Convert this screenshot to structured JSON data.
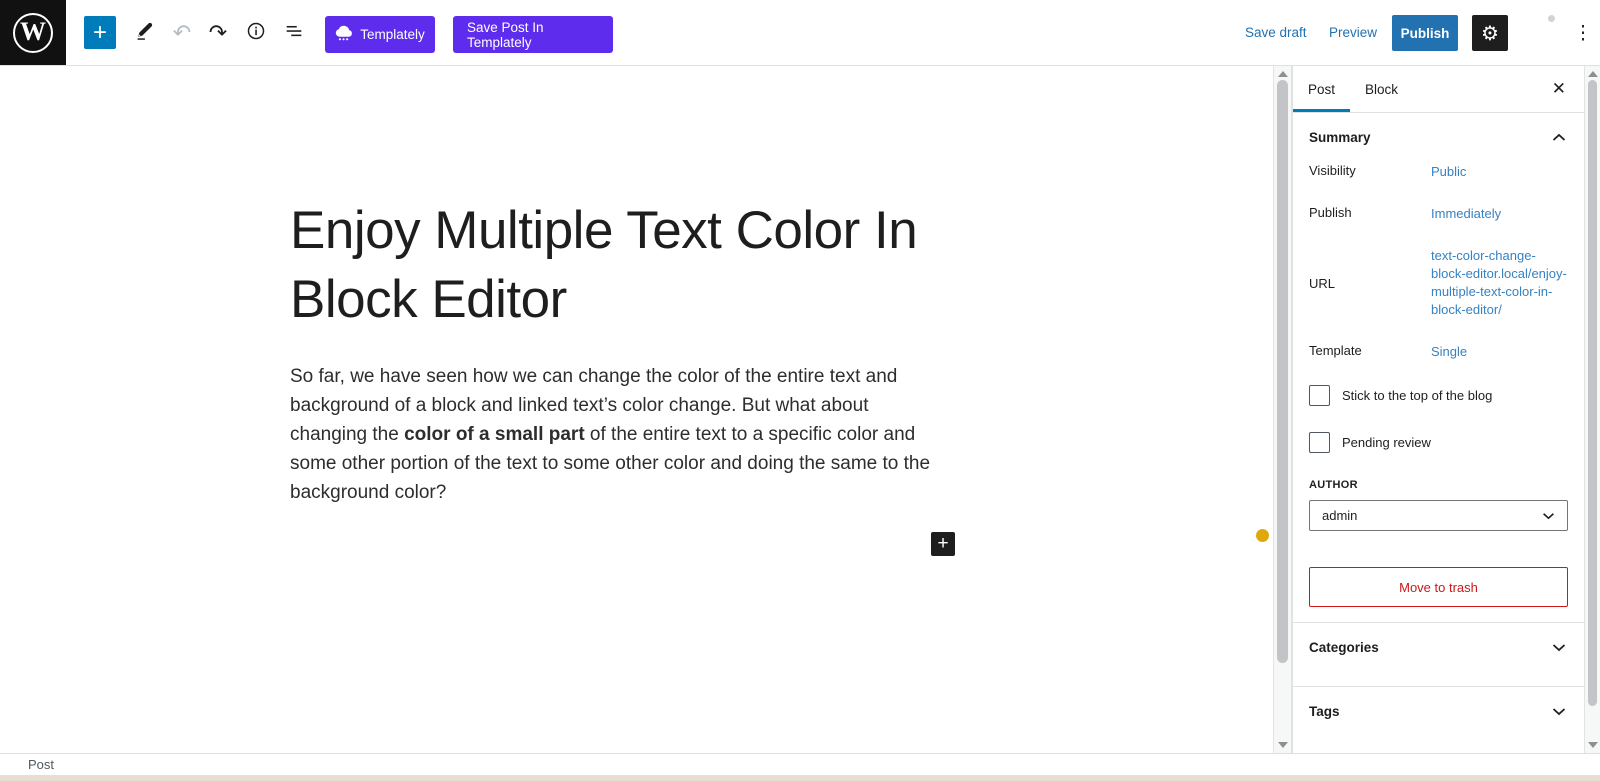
{
  "header": {
    "wp_logo_letter": "W",
    "templately_label": "Templately",
    "save_post_label": "Save Post In Templately",
    "save_draft_label": "Save draft",
    "preview_label": "Preview",
    "publish_label": "Publish"
  },
  "editor": {
    "post_title": "Enjoy Multiple Text Color In Block Editor",
    "paragraph_before": "So far, we have seen how we can change the color of the entire text and background of a block and linked text’s color change. But what about changing the ",
    "paragraph_bold": "color of a small part",
    "paragraph_after": " of the entire text to a specific color and some other portion of the text to some other color and doing the same to the background color?",
    "block_inserter_glyph": "+"
  },
  "sidebar": {
    "tabs": {
      "post": "Post",
      "block": "Block"
    },
    "summary_title": "Summary",
    "rows": [
      {
        "label": "Visibility",
        "value": "Public"
      },
      {
        "label": "Publish",
        "value": "Immediately"
      },
      {
        "label": "URL",
        "value": "text-color-change-block-editor.local/enjoy-multiple-text-color-in-block-editor/"
      },
      {
        "label": "Template",
        "value": "Single"
      }
    ],
    "checkbox_stick_label": "Stick to the top of the blog",
    "checkbox_pending_label": "Pending review",
    "author_label": "AUTHOR",
    "author_value": "admin",
    "move_to_trash_label": "Move to trash",
    "categories_title": "Categories",
    "tags_title": "Tags"
  },
  "footer": {
    "breadcrumb": "Post"
  },
  "colors": {
    "brand_purple": "#5e2ced",
    "toolbar_blue": "#007cba",
    "publish_blue": "#2271b1",
    "link_blue": "#3582c4",
    "danger_red": "#cc1818",
    "recording_dot_yellow": "#dfa90d"
  }
}
